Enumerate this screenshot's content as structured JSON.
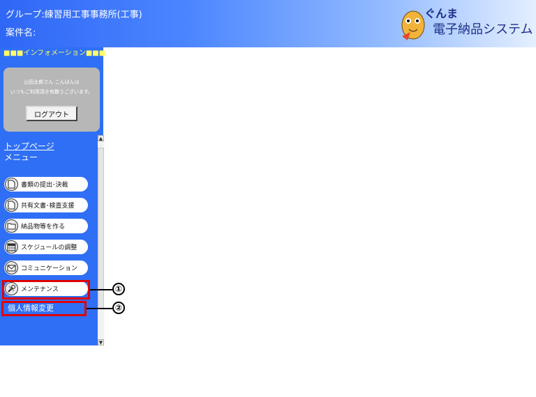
{
  "header": {
    "group": "グループ:練習用工事事務所(工事)",
    "project": "案件名:",
    "logo_top": "ぐんま",
    "logo_bottom": "電子納品システム"
  },
  "sidebar": {
    "info_bar": "■■■インフォメーション■■■",
    "greeting_line1": "山田太郎さん こんばんは",
    "greeting_line2": "いつもご利用頂き有難うございます。",
    "logout_label": "ログアウト",
    "top_page": "トップページ",
    "menu_label": "メニュー",
    "menu_items": [
      {
        "label": "書類の提出･決裁",
        "icon": "document-icon"
      },
      {
        "label": "共有文書･検査支援",
        "icon": "document-icon"
      },
      {
        "label": "納品物等を作る",
        "icon": "folder-icon"
      },
      {
        "label": "スケジュールの調整",
        "icon": "calendar-icon"
      },
      {
        "label": "コミュニケーション",
        "icon": "mail-icon"
      },
      {
        "label": "メンテナンス",
        "icon": "tools-icon"
      }
    ],
    "sub_item": "個人情報変更"
  },
  "callouts": [
    "①",
    "②"
  ],
  "colors": {
    "sidebar": "#2f6ff5",
    "highlight": "#e00000",
    "header_start": "#2f67f6"
  }
}
